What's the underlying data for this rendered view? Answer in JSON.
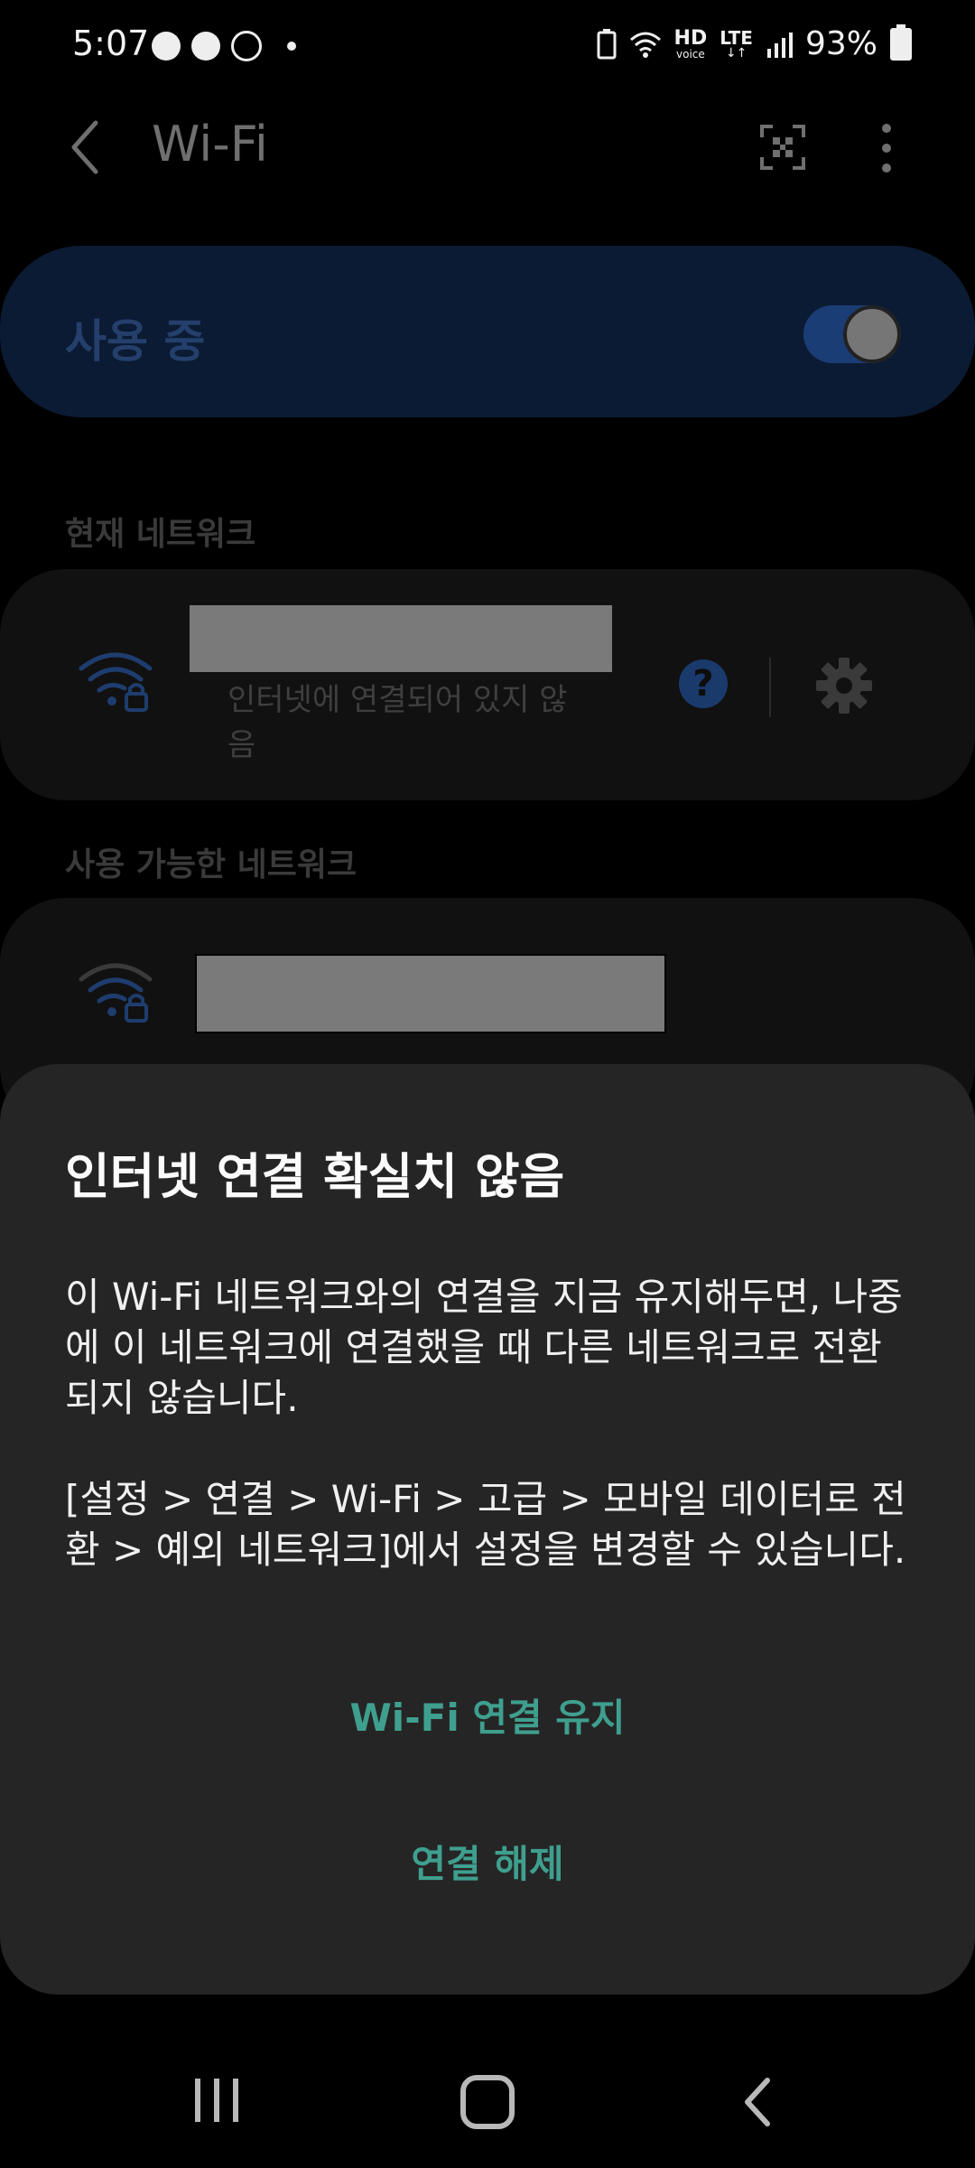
{
  "status_bar": {
    "time": "5:07",
    "battery": "93%",
    "hd_label": "HD",
    "voice_label": "voice",
    "lte_label": "LTE"
  },
  "header": {
    "title": "Wi-Fi"
  },
  "wifi_toggle": {
    "label": "사용 중",
    "on": true
  },
  "sections": {
    "current": "현재 네트워크",
    "available": "사용 가능한 네트워크"
  },
  "current_network": {
    "status": "인터넷에 연결되어 있지 않음"
  },
  "dialog": {
    "title": "인터넷 연결 확실치 않음",
    "paragraph1": "이 Wi-Fi 네트워크와의 연결을 지금 유지해두면, 나중에 이 네트워크에 연결했을 때 다른 네트워크로 전환되지 않습니다.",
    "paragraph2": "[설정 > 연결 > Wi-Fi > 고급 > 모바일 데이터로 전환 > 예외 네트워크]에서 설정을 변경할 수 있습니다.",
    "keep_button": "Wi-Fi 연결 유지",
    "disconnect_button": "연결 해제"
  },
  "icons": {
    "back": "back-arrow-icon",
    "qr": "qr-code-icon",
    "more": "more-vert-icon",
    "wifi_lock": "wifi-lock-icon",
    "help": "help-icon",
    "settings": "gear-icon"
  },
  "colors": {
    "accent_teal": "#3f9f8e",
    "toggle_blue": "#1b3d75",
    "card_blue": "#0b1b33"
  }
}
